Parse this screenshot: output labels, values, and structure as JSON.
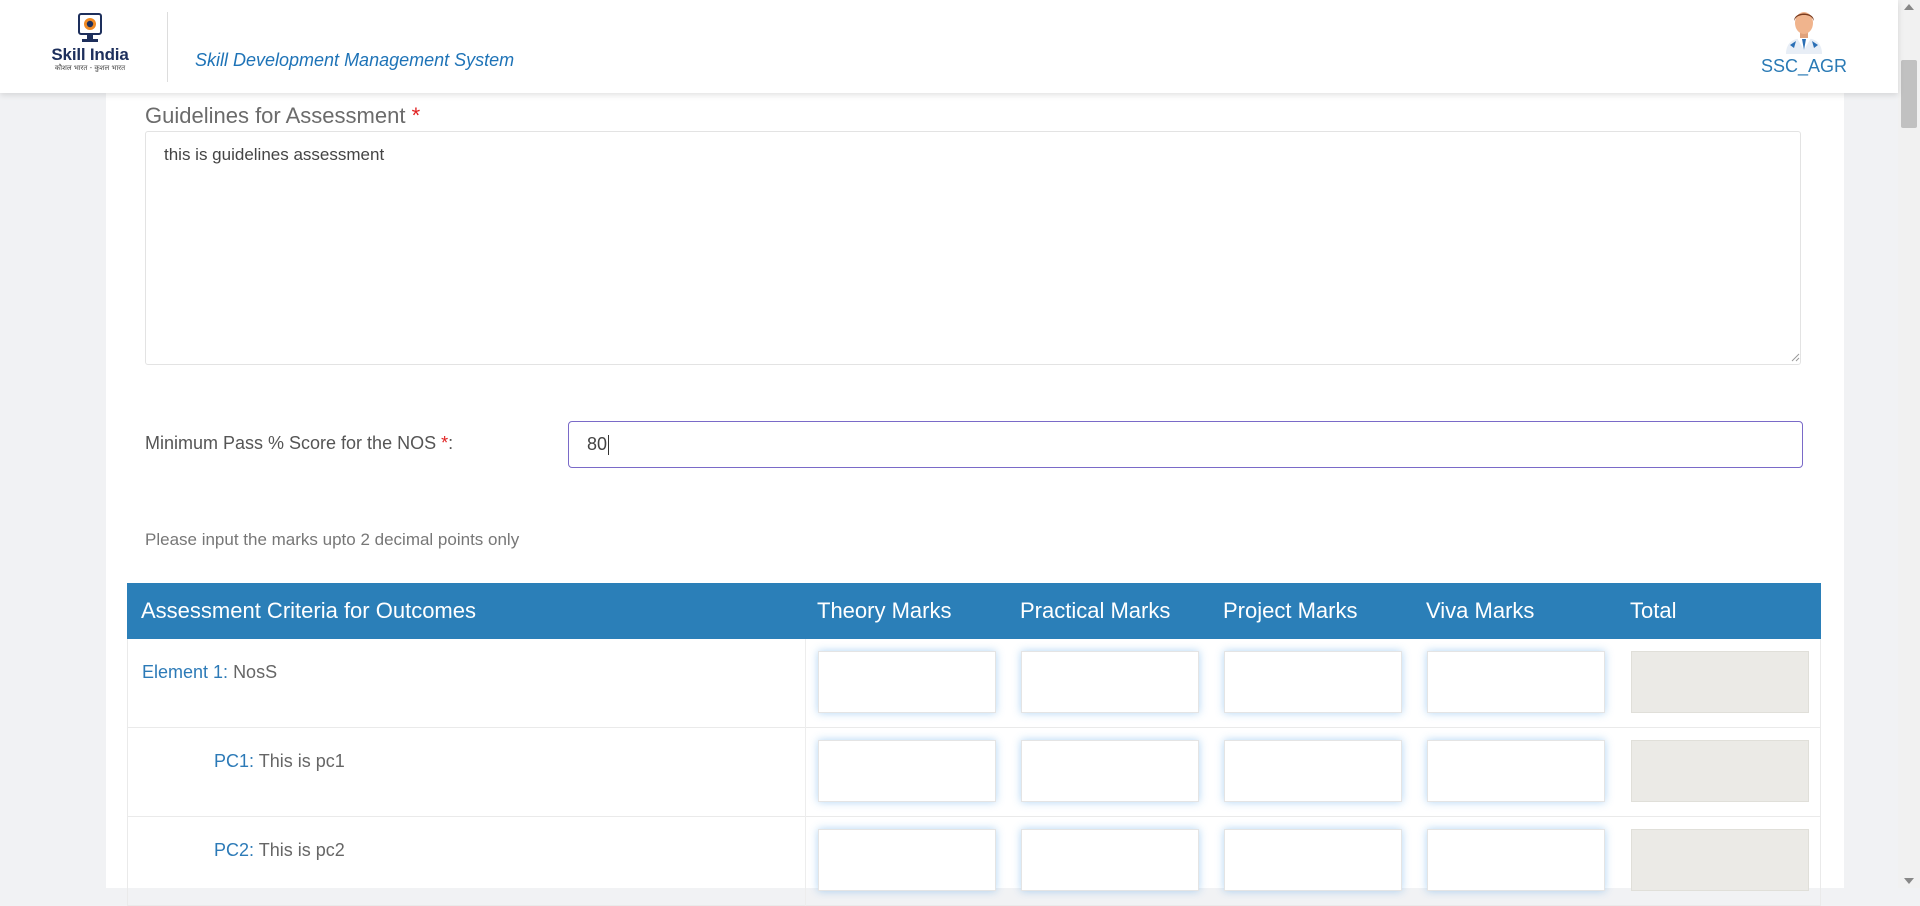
{
  "header": {
    "logo_text": "Skill India",
    "logo_subtext": "कौशल भारत - कुशल भारत",
    "system_title": "Skill Development Management System",
    "user_name": "SSC_AGR",
    "user_icon": "user-avatar-icon"
  },
  "form": {
    "guidelines_label": "Guidelines for Assessment",
    "required_mark": "*",
    "guidelines_value": "this is guidelines assessment",
    "pass_label": "Minimum Pass % Score for the NOS",
    "pass_colon": ":",
    "pass_value": "80",
    "note": "Please input the marks upto 2 decimal points only"
  },
  "table": {
    "headers": [
      "Assessment Criteria for Outcomes",
      "Theory Marks",
      "Practical Marks",
      "Project Marks",
      "Viva Marks",
      "Total"
    ],
    "rows": [
      {
        "key": "Element 1",
        "sep": ": ",
        "value": "NosS"
      },
      {
        "key": "PC1",
        "sep": ": ",
        "value": "This is pc1"
      },
      {
        "key": "PC2",
        "sep": ": ",
        "value": "This is pc2"
      }
    ]
  },
  "colors": {
    "accent": "#2b7fb8",
    "required": "#e02020",
    "focus_border": "#7a6ac8"
  }
}
